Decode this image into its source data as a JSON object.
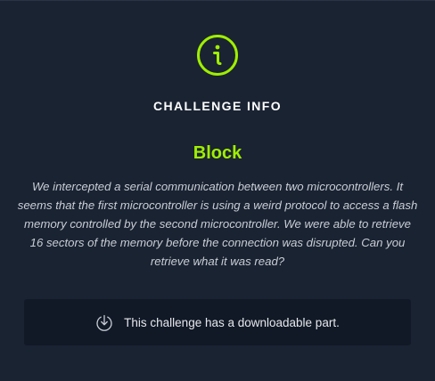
{
  "modal": {
    "heading": "CHALLENGE INFO",
    "challenge_name": "Block",
    "description": "We intercepted a serial communication between two microcontrollers. It seems that the first microcontroller is using a weird protocol to access a flash memory controlled by the second microcontroller. We were able to retrieve 16 sectors of the memory before the connection was disrupted. Can you retrieve what it was read?",
    "download_text": "This challenge has a downloadable part.",
    "icons": {
      "header": "info-icon",
      "download": "download-icon"
    },
    "colors": {
      "accent": "#9fef00",
      "background": "#1a2332",
      "panel": "#111927"
    }
  }
}
